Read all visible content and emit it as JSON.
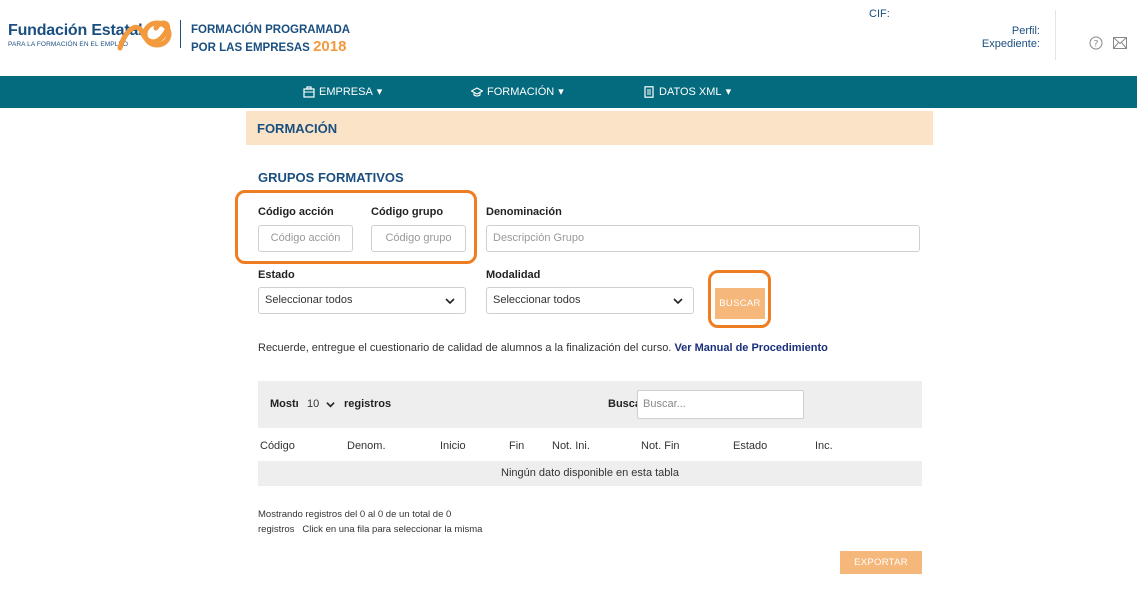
{
  "header": {
    "logo_name": "Fundación Estatal",
    "logo_tagline": "PARA LA FORMACIÓN EN EL EMPLEO",
    "program_line1": "FORMACIÓN PROGRAMADA",
    "program_line2": "POR LAS EMPRESAS",
    "program_year": "2018",
    "cif_label": "CIF:",
    "perfil_label": "Perfil:",
    "expediente_label": "Expediente:",
    "icons": [
      "help-circle-icon",
      "mail-icon"
    ]
  },
  "nav": {
    "items": [
      {
        "label": "EMPRESA",
        "icon": "briefcase-icon"
      },
      {
        "label": "FORMACIÓN",
        "icon": "graduation-cap-icon"
      },
      {
        "label": "DATOS XML",
        "icon": "document-icon"
      }
    ],
    "caret": "▾",
    "bg_color": "#046a7d"
  },
  "page": {
    "section_title": "FORMACIÓN",
    "subtitle": "GRUPOS FORMATIVOS"
  },
  "filters": {
    "codigo_accion": {
      "label": "Código acción",
      "placeholder": "Código acción"
    },
    "codigo_grupo": {
      "label": "Código grupo",
      "placeholder": "Código grupo"
    },
    "denominacion": {
      "label": "Denominación",
      "placeholder": "Descripción Grupo"
    },
    "estado": {
      "label": "Estado",
      "selected": "Seleccionar todos"
    },
    "modalidad": {
      "label": "Modalidad",
      "selected": "Seleccionar todos"
    },
    "search_button": "BUSCAR"
  },
  "notice": {
    "text": "Recuerde, entregue el cuestionario de calidad de alumnos a la finalización del curso.",
    "link": "Ver Manual de Procedimiento"
  },
  "table": {
    "show_label": "Mostrar",
    "page_length": "10",
    "records_label": "registros",
    "search_label": "Buscar:",
    "search_placeholder": "Buscar...",
    "columns": [
      "Código",
      "Denom.",
      "Inicio",
      "Fin",
      "Not. Ini.",
      "Not. Fin",
      "Estado",
      "Inc."
    ],
    "empty_message": "Ningún dato disponible en esta tabla",
    "info_line1": "Mostrando registros del 0 al 0 de un total de 0",
    "info_line2": "registros   Click en una fila para seleccionar la misma",
    "export_button": "EXPORTAR EXCEL"
  },
  "colors": {
    "accent_orange": "#ef7d22",
    "button_orange": "#f5b77a",
    "brand_blue": "#1a4f80",
    "banner_bg": "#fae3c6"
  }
}
